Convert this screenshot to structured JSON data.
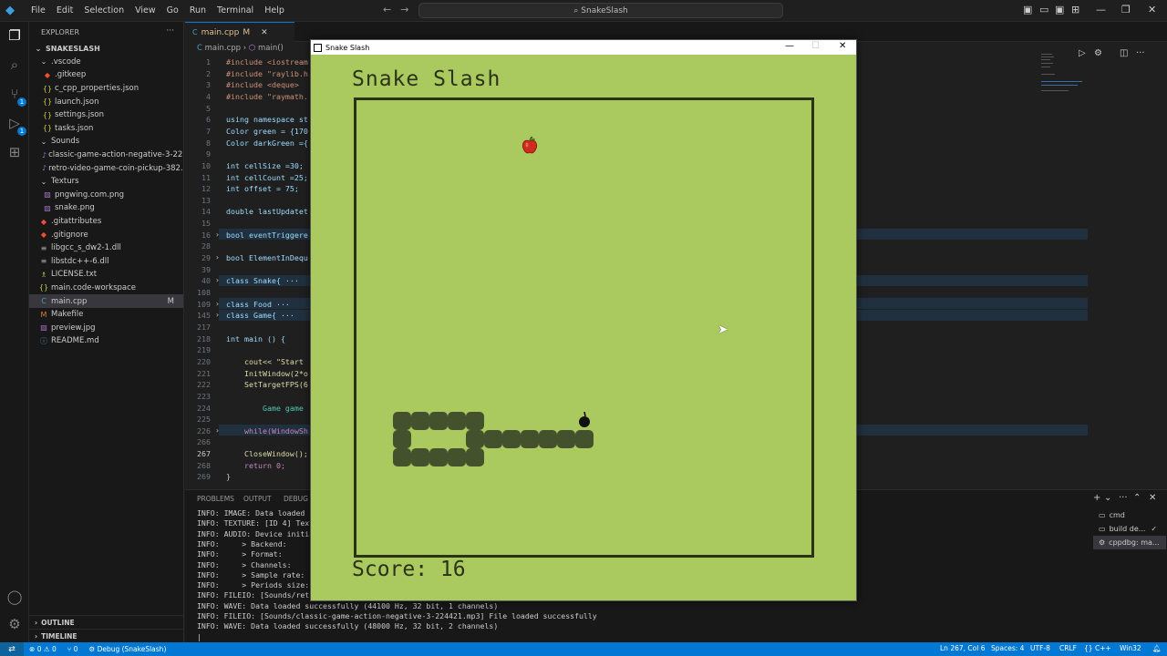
{
  "menu": [
    "File",
    "Edit",
    "Selection",
    "View",
    "Go",
    "Run",
    "Terminal",
    "Help"
  ],
  "command_center": "SnakeSlash",
  "explorer": {
    "title": "EXPLORER",
    "root": "SNAKESLASH",
    "items": [
      {
        "label": ".vscode",
        "kind": "folder",
        "depth": 1,
        "icon": "chevron-down-icon"
      },
      {
        "label": ".gitkeep",
        "kind": "file",
        "depth": 2,
        "icon": "git-icon"
      },
      {
        "label": "c_cpp_properties.json",
        "kind": "file",
        "depth": 2,
        "icon": "json-icon"
      },
      {
        "label": "launch.json",
        "kind": "file",
        "depth": 2,
        "icon": "json-icon"
      },
      {
        "label": "settings.json",
        "kind": "file",
        "depth": 2,
        "icon": "json-icon"
      },
      {
        "label": "tasks.json",
        "kind": "file",
        "depth": 2,
        "icon": "json-icon"
      },
      {
        "label": "Sounds",
        "kind": "folder",
        "depth": 1,
        "icon": "chevron-down-icon"
      },
      {
        "label": "classic-game-action-negative-3-22...",
        "kind": "file",
        "depth": 2,
        "icon": "audio-icon"
      },
      {
        "label": "retro-video-game-coin-pickup-382...",
        "kind": "file",
        "depth": 2,
        "icon": "audio-icon"
      },
      {
        "label": "Texturs",
        "kind": "folder",
        "depth": 1,
        "icon": "chevron-down-icon"
      },
      {
        "label": "pngwing.com.png",
        "kind": "file",
        "depth": 2,
        "icon": "image-icon"
      },
      {
        "label": "snake.png",
        "kind": "file",
        "depth": 2,
        "icon": "image-icon"
      },
      {
        "label": ".gitattributes",
        "kind": "file",
        "depth": 1,
        "icon": "git-icon"
      },
      {
        "label": ".gitignore",
        "kind": "file",
        "depth": 1,
        "icon": "git-icon"
      },
      {
        "label": "libgcc_s_dw2-1.dll",
        "kind": "file",
        "depth": 1,
        "icon": "dll-icon"
      },
      {
        "label": "libstdc++-6.dll",
        "kind": "file",
        "depth": 1,
        "icon": "dll-icon"
      },
      {
        "label": "LICENSE.txt",
        "kind": "file",
        "depth": 1,
        "icon": "license-icon"
      },
      {
        "label": "main.code-workspace",
        "kind": "file",
        "depth": 1,
        "icon": "json-icon"
      },
      {
        "label": "main.cpp",
        "kind": "file",
        "depth": 1,
        "icon": "cpp-icon",
        "active": true,
        "modified": "M"
      },
      {
        "label": "Makefile",
        "kind": "file",
        "depth": 1,
        "icon": "makefile-icon"
      },
      {
        "label": "preview.jpg",
        "kind": "file",
        "depth": 1,
        "icon": "image-icon"
      },
      {
        "label": "README.md",
        "kind": "file",
        "depth": 1,
        "icon": "info-icon"
      }
    ],
    "outline": "OUTLINE",
    "timeline": "TIMELINE"
  },
  "editor": {
    "tab_label": "main.cpp",
    "tab_modified": "M",
    "breadcrumb_file": "main.cpp",
    "breadcrumb_symbol": "main()",
    "lines": [
      {
        "n": "1",
        "text": "#include <iostream"
      },
      {
        "n": "2",
        "text": "#include \"raylib.h"
      },
      {
        "n": "3",
        "text": "#include <deque>"
      },
      {
        "n": "4",
        "text": "#include \"raymath."
      },
      {
        "n": "5",
        "text": ""
      },
      {
        "n": "6",
        "text": "using namespace st"
      },
      {
        "n": "7",
        "text": "Color green = {170"
      },
      {
        "n": "8",
        "text": "Color darkGreen ={"
      },
      {
        "n": "9",
        "text": ""
      },
      {
        "n": "10",
        "text": "int cellSize =30;"
      },
      {
        "n": "11",
        "text": "int cellCount =25;"
      },
      {
        "n": "12",
        "text": "int offset = 75;"
      },
      {
        "n": "13",
        "text": ""
      },
      {
        "n": "14",
        "text": "double lastUpdatet"
      },
      {
        "n": "15",
        "text": ""
      },
      {
        "n": "16",
        "text": "bool eventTriggere",
        "fold": true
      },
      {
        "n": "28",
        "text": ""
      },
      {
        "n": "29",
        "text": "bool ElementInDequ",
        "fold": true
      },
      {
        "n": "39",
        "text": ""
      },
      {
        "n": "40",
        "text": "class Snake{ ···",
        "fold": true
      },
      {
        "n": "108",
        "text": ""
      },
      {
        "n": "109",
        "text": "class Food ···",
        "fold": true
      },
      {
        "n": "145",
        "text": "class Game{ ···",
        "fold": true
      },
      {
        "n": "217",
        "text": ""
      },
      {
        "n": "218",
        "text": "int main () {"
      },
      {
        "n": "219",
        "text": ""
      },
      {
        "n": "220",
        "text": "    cout<< \"Start"
      },
      {
        "n": "221",
        "text": "    InitWindow(2*o"
      },
      {
        "n": "222",
        "text": "    SetTargetFPS(6"
      },
      {
        "n": "223",
        "text": ""
      },
      {
        "n": "224",
        "text": "        Game game"
      },
      {
        "n": "225",
        "text": ""
      },
      {
        "n": "226",
        "text": "    while(WindowSh",
        "fold": true
      },
      {
        "n": "266",
        "text": ""
      },
      {
        "n": "267",
        "text": "    CloseWindow();",
        "current": true
      },
      {
        "n": "268",
        "text": "    return 0;"
      },
      {
        "n": "269",
        "text": "}"
      }
    ]
  },
  "panel": {
    "tabs": [
      "PROBLEMS",
      "OUTPUT",
      "DEBUG C"
    ],
    "terminal_lines": [
      "INFO: IMAGE: Data loaded su",
      "INFO: TEXTURE: [ID 4] Textu",
      "INFO: AUDIO: Device initial",
      "INFO:     > Backend:",
      "INFO:     > Format:",
      "INFO:     > Channels:",
      "INFO:     > Sample rate:",
      "INFO:     > Periods size:",
      "INFO: FILEIO: [Sounds/retro",
      "INFO: WAVE: Data loaded successfully (44100 Hz, 32 bit, 1 channels)",
      "INFO: FILEIO: [Sounds/classic-game-action-negative-3-224421.mp3] File loaded successfully",
      "INFO: WAVE: Data loaded successfully (48000 Hz, 32 bit, 2 channels)",
      "|"
    ],
    "terminals": [
      "cmd",
      "build de...",
      "cppdbg: ma..."
    ]
  },
  "status": {
    "errors": "0",
    "warnings": "0",
    "ports": "0",
    "debug": "Debug (SnakeSlash)",
    "position": "Ln 267, Col 6",
    "spaces": "Spaces: 4",
    "encoding": "UTF-8",
    "eol": "CRLF",
    "braces": "{}",
    "language": "C++",
    "platform": "Win32"
  },
  "game": {
    "window_title": "Snake Slash",
    "title": "Snake Slash",
    "score_label": "Score: 16",
    "colors": {
      "background": "#aac95f",
      "dark": "#2b3317",
      "snake": "#43512c"
    }
  }
}
